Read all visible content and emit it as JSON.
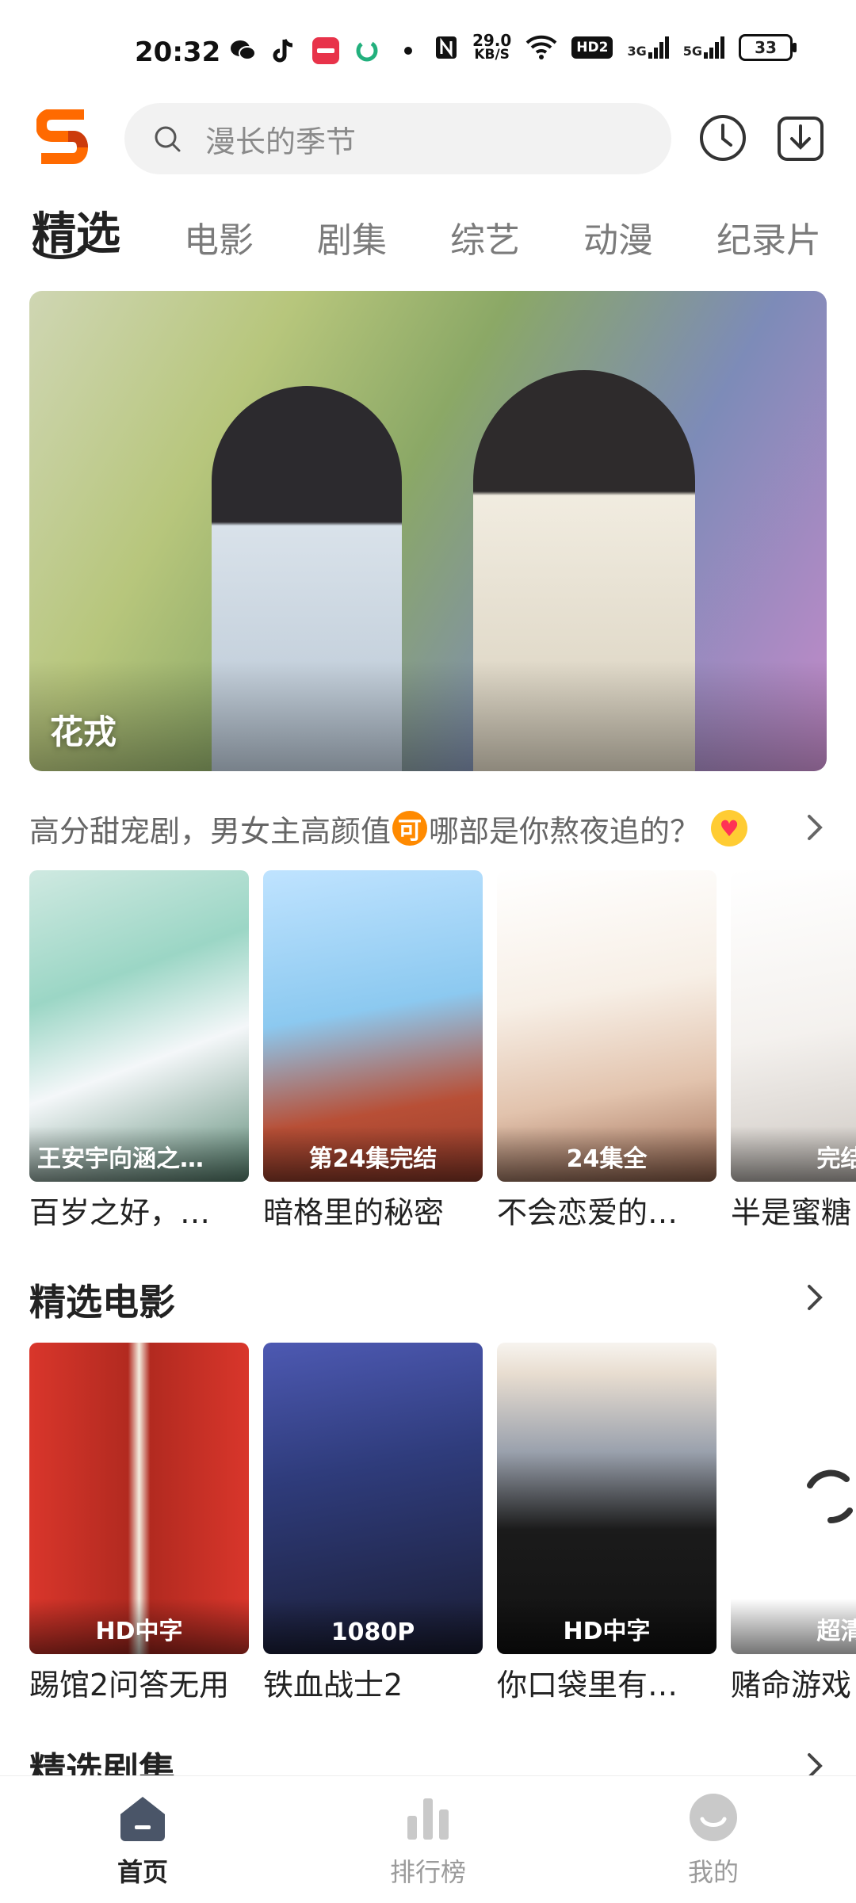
{
  "status_bar": {
    "time": "20:32",
    "rate_value": "29.0",
    "rate_unit": "KB/S",
    "hd_label": "HD2",
    "network_3g": "3G",
    "network_5g": "5G",
    "battery": "33"
  },
  "search": {
    "placeholder": "漫长的季节"
  },
  "tabs": [
    "精选",
    "电影",
    "剧集",
    "综艺",
    "动漫",
    "纪录片"
  ],
  "banner": {
    "caption": "花戎"
  },
  "promo": {
    "text_before": "高分甜宠剧，男女主高颜值",
    "badge": "可",
    "text_after": "哪部是你熬夜追的？"
  },
  "drama_row": [
    {
      "badge": "王安宇向涵之…",
      "title": "百岁之好，…"
    },
    {
      "badge": "第24集完结",
      "title": "暗格里的秘密"
    },
    {
      "badge": "24集全",
      "title": "不会恋爱的…"
    },
    {
      "badge": "完结",
      "title": "半是蜜糖"
    }
  ],
  "featured_movies": {
    "section_title": "精选电影",
    "items": [
      {
        "badge": "HD中字",
        "title": "踢馆2问答无用"
      },
      {
        "badge": "1080P",
        "title": "铁血战士2"
      },
      {
        "badge": "HD中字",
        "title": "你口袋里有…"
      },
      {
        "badge": "超清",
        "title": "赌命游戏"
      }
    ]
  },
  "next_section": {
    "title": "精选剧集"
  },
  "bottom_nav": [
    {
      "label": "首页",
      "active": true
    },
    {
      "label": "排行榜",
      "active": false
    },
    {
      "label": "我的",
      "active": false
    }
  ],
  "colors": {
    "accent": "#ff6a00",
    "text_primary": "#222222",
    "text_secondary": "#7b7b7b"
  }
}
